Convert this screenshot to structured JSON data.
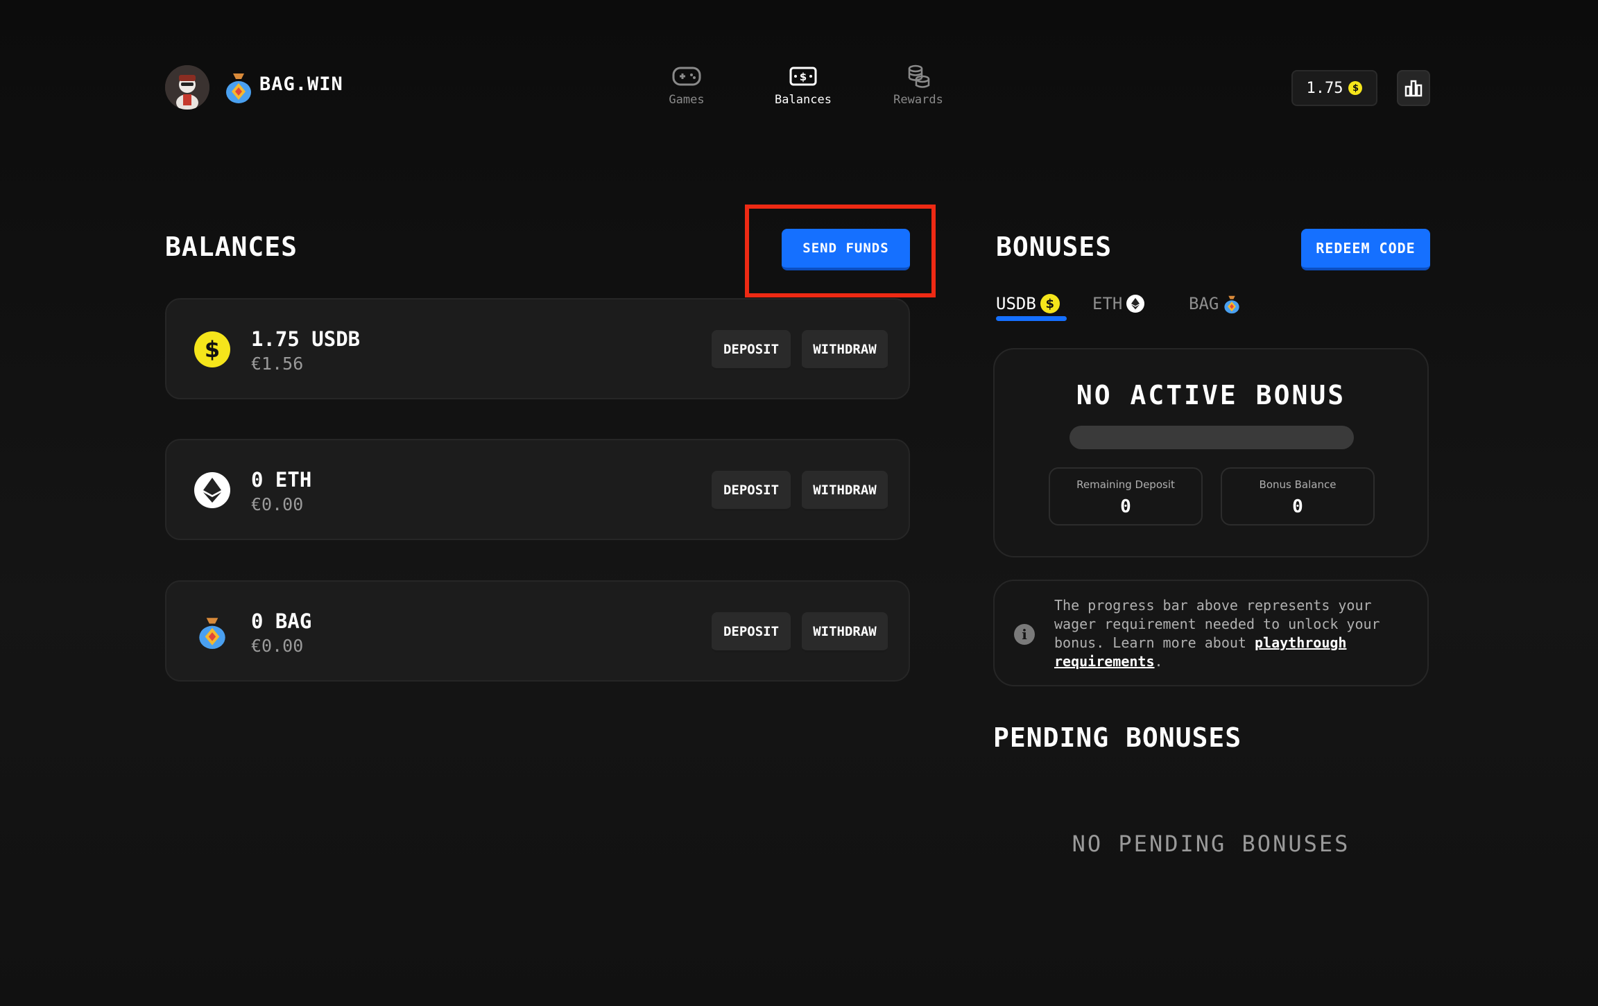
{
  "header": {
    "brand": "BAG.WIN",
    "nav": [
      {
        "label": "Games",
        "icon": "gamepad-icon",
        "active": false
      },
      {
        "label": "Balances",
        "icon": "cash-icon",
        "active": true
      },
      {
        "label": "Rewards",
        "icon": "coins-stack-icon",
        "active": false
      }
    ],
    "wallet_balance": "1.75"
  },
  "balances": {
    "title": "BALANCES",
    "send_funds_label": "SEND FUNDS",
    "items": [
      {
        "amount": "1.75 USDB",
        "fiat": "€1.56",
        "icon": "usdb-coin-icon",
        "deposit": "DEPOSIT",
        "withdraw": "WITHDRAW"
      },
      {
        "amount": "0 ETH",
        "fiat": "€0.00",
        "icon": "eth-coin-icon",
        "deposit": "DEPOSIT",
        "withdraw": "WITHDRAW"
      },
      {
        "amount": "0 BAG",
        "fiat": "€0.00",
        "icon": "bag-coin-icon",
        "deposit": "DEPOSIT",
        "withdraw": "WITHDRAW"
      }
    ]
  },
  "bonuses": {
    "title": "BONUSES",
    "redeem_label": "REDEEM CODE",
    "tabs": [
      {
        "label": "USDB",
        "active": true
      },
      {
        "label": "ETH",
        "active": false
      },
      {
        "label": "BAG",
        "active": false
      }
    ],
    "active_bonus_title": "NO ACTIVE BONUS",
    "progress": 0,
    "remaining_deposit_label": "Remaining Deposit",
    "remaining_deposit_value": "0",
    "bonus_balance_label": "Bonus Balance",
    "bonus_balance_value": "0",
    "info_text": "The progress bar above represents your wager requirement needed to unlock your bonus. Learn more about ",
    "info_link": "playthrough requirements",
    "info_end": ".",
    "pending_title": "PENDING BONUSES",
    "no_pending": "NO PENDING BONUSES"
  },
  "colors": {
    "accent": "#1570ff",
    "highlight": "#ee2a14",
    "usdb": "#f5e51b"
  }
}
